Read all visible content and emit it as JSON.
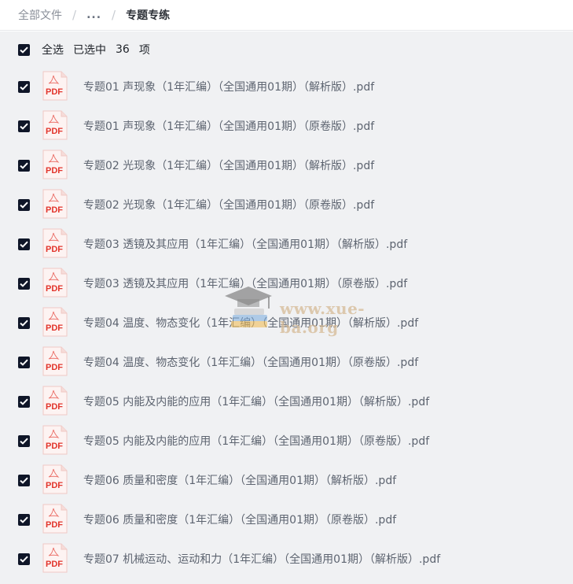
{
  "breadcrumb": {
    "root": "全部文件",
    "ellipsis": "...",
    "current": "专题专练"
  },
  "selection": {
    "select_all_label": "全选",
    "selected_prefix": "已选中",
    "selected_count": "36",
    "selected_suffix": "项",
    "checked": true
  },
  "files": [
    {
      "name": "专题01 声现象（1年汇编）（全国通用01期）（解析版）.pdf",
      "checked": true
    },
    {
      "name": "专题01 声现象（1年汇编）（全国通用01期）（原卷版）.pdf",
      "checked": true
    },
    {
      "name": "专题02 光现象（1年汇编）（全国通用01期）（解析版）.pdf",
      "checked": true
    },
    {
      "name": "专题02 光现象（1年汇编）（全国通用01期）（原卷版）.pdf",
      "checked": true
    },
    {
      "name": "专题03 透镜及其应用（1年汇编）（全国通用01期）（解析版）.pdf",
      "checked": true
    },
    {
      "name": "专题03 透镜及其应用（1年汇编）（全国通用01期）（原卷版）.pdf",
      "checked": true
    },
    {
      "name": "专题04 温度、物态变化（1年汇编）（全国通用01期）（解析版）.pdf",
      "checked": true
    },
    {
      "name": "专题04 温度、物态变化（1年汇编）（全国通用01期）（原卷版）.pdf",
      "checked": true
    },
    {
      "name": "专题05 内能及内能的应用（1年汇编）（全国通用01期）（解析版）.pdf",
      "checked": true
    },
    {
      "name": "专题05 内能及内能的应用（1年汇编）（全国通用01期）（原卷版）.pdf",
      "checked": true
    },
    {
      "name": "专题06 质量和密度（1年汇编）（全国通用01期）（解析版）.pdf",
      "checked": true
    },
    {
      "name": "专题06 质量和密度（1年汇编）（全国通用01期）（原卷版）.pdf",
      "checked": true
    },
    {
      "name": "专题07 机械运动、运动和力（1年汇编）（全国通用01期）（解析版）.pdf",
      "checked": true
    }
  ],
  "file_icon": {
    "name": "pdf-file-icon",
    "label": "PDF",
    "color": "#e2342b"
  },
  "checkbox_color": "#0f1628",
  "watermark": {
    "text": "www.xue-ba.org",
    "icon": "graduation-cap-books-icon"
  }
}
